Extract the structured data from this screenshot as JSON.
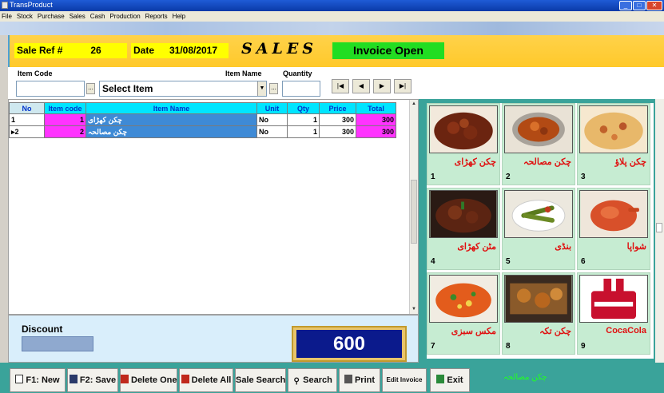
{
  "window": {
    "title": "TransProduct"
  },
  "menu": [
    "File",
    "Stock",
    "Purchase",
    "Sales",
    "Cash",
    "Production",
    "Reports",
    "Help"
  ],
  "header": {
    "sale_ref_label": "Sale Ref #",
    "sale_ref_value": "26",
    "date_label": "Date",
    "date_value": "31/08/2017",
    "title": "SALES",
    "status": "Invoice Open"
  },
  "entry": {
    "item_code_label": "Item Code",
    "item_code_value": "",
    "item_name_label": "Item Name",
    "item_select_value": "Select Item",
    "quantity_label": "Quantity",
    "quantity_value": "",
    "browse_label": "...",
    "nav": {
      "first": "|◀",
      "prev": "◀",
      "next": "▶",
      "last": "▶|"
    }
  },
  "grid": {
    "columns": [
      "No",
      "Item code",
      "Item Name",
      "Unit",
      "Qty",
      "Price",
      "Total"
    ],
    "rows": [
      {
        "no": "1",
        "code": "1",
        "name": "چکن کھڑای",
        "unit": "No",
        "qty": "1",
        "price": "300",
        "total": "300",
        "current": false
      },
      {
        "no": "2",
        "code": "2",
        "name": "چکن مصالحہ",
        "unit": "No",
        "qty": "1",
        "price": "300",
        "total": "300",
        "current": true
      }
    ]
  },
  "gallery": [
    {
      "num": "1",
      "name": "چکن کھڑای",
      "img": "karahi"
    },
    {
      "num": "2",
      "name": "چکن مصالحہ",
      "img": "masala"
    },
    {
      "num": "3",
      "name": "چکن پلاؤ",
      "img": "pulao"
    },
    {
      "num": "4",
      "name": "مٹن کھڑای",
      "img": "mutton"
    },
    {
      "num": "5",
      "name": "بنڈی",
      "img": "bhindi"
    },
    {
      "num": "6",
      "name": "شواپا",
      "img": "roast"
    },
    {
      "num": "7",
      "name": "مکس سبزی",
      "img": "mix"
    },
    {
      "num": "8",
      "name": "چکن تکہ",
      "img": "tikka"
    },
    {
      "num": "9",
      "name": "CocaCola",
      "img": "cola"
    }
  ],
  "totals": {
    "discount_label": "Discount",
    "discount_value": "",
    "grand_total": "600"
  },
  "buttons": {
    "new": "F1: New",
    "save": "F2: Save",
    "delete_one": "Delete One",
    "delete_all": "Delete All",
    "sale_search": "Sale Search",
    "search": "Search",
    "print": "Print",
    "edit_invoice": "Edit Invoice",
    "exit": "Exit"
  },
  "status_text": "چکن مصالحہ",
  "colors": {
    "header_bg": "#ffc92a",
    "header_label_bg": "#ffff00",
    "invoice_open_bg": "#22dd22",
    "grid_header_bg": "#00e5ff",
    "row_highlight": "#3e8ad6",
    "code_cell": "#ff33ff",
    "total_cell": "#ff33ff",
    "gallery_bg": "#3aa39a",
    "tile_bg": "#c6ecd2",
    "item_name_color": "#e01010",
    "grand_total_bg": "#0b1a8c"
  }
}
